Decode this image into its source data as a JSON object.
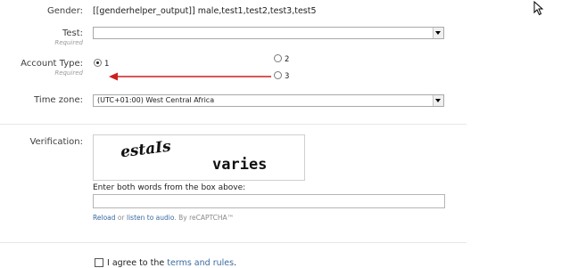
{
  "gender": {
    "label": "Gender:",
    "value": "[[genderhelper_output]] male,test1,test2,test3,test5"
  },
  "test": {
    "label": "Test:",
    "required": "Required",
    "selected": ""
  },
  "account_type": {
    "label": "Account Type:",
    "required": "Required",
    "options": [
      {
        "label": "1",
        "checked": true
      },
      {
        "label": "2",
        "checked": false
      },
      {
        "label": "3",
        "checked": false
      }
    ]
  },
  "timezone": {
    "label": "Time zone:",
    "selected": "(UTC+01:00) West Central Africa"
  },
  "verification": {
    "label": "Verification:",
    "captcha_word1": "estaIs",
    "captcha_word2": "varies",
    "instructions": "Enter both words from the box above:",
    "input_value": "",
    "reload_link": "Reload",
    "or_text": "or",
    "audio_link": "listen to audio",
    "by_text": ". By reCAPTCHA™"
  },
  "agree": {
    "prefix": "I agree to the",
    "link": "terms and rules",
    "suffix": "."
  },
  "colors": {
    "annotation_arrow": "#cc1f1f",
    "link": "#3a6aa0"
  },
  "icons": {
    "cursor": "mouse-pointer-icon"
  }
}
